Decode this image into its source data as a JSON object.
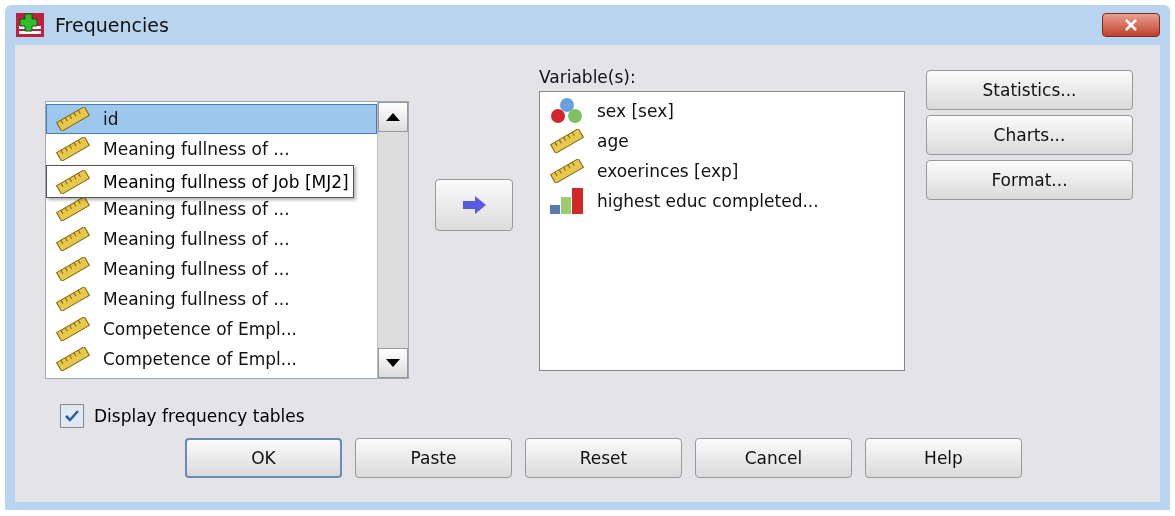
{
  "window": {
    "title": "Frequencies"
  },
  "source_list": {
    "items": [
      {
        "label": "id",
        "kind": "scale",
        "selected": true
      },
      {
        "label": "Meaning fullness of ...",
        "kind": "scale",
        "selected": false
      },
      {
        "kind": "scale",
        "selected": false,
        "tooltip": "Meaning fullness of Job [MJ2]"
      },
      {
        "label": "Meaning fullness of ...",
        "kind": "scale",
        "selected": false
      },
      {
        "label": "Meaning fullness of ...",
        "kind": "scale",
        "selected": false
      },
      {
        "label": "Meaning fullness of ...",
        "kind": "scale",
        "selected": false
      },
      {
        "label": "Meaning fullness of ...",
        "kind": "scale",
        "selected": false
      },
      {
        "label": "Competence of Empl...",
        "kind": "scale",
        "selected": false
      },
      {
        "label": "Competence of Empl...",
        "kind": "scale",
        "selected": false
      }
    ]
  },
  "target_list": {
    "label": "Variable(s):",
    "items": [
      {
        "label": "sex [sex]",
        "kind": "nominal"
      },
      {
        "label": "age",
        "kind": "scale"
      },
      {
        "label": "exoerinces [exp]",
        "kind": "scale"
      },
      {
        "label": "highest educ completed...",
        "kind": "ordinal"
      }
    ]
  },
  "side_buttons": [
    "Statistics...",
    "Charts...",
    "Format..."
  ],
  "display_frequency_tables": {
    "label": "Display frequency tables",
    "checked": true
  },
  "buttons": [
    {
      "label": "OK",
      "default": true
    },
    {
      "label": "Paste",
      "default": false
    },
    {
      "label": "Reset",
      "default": false
    },
    {
      "label": "Cancel",
      "default": false
    },
    {
      "label": "Help",
      "default": false
    }
  ]
}
